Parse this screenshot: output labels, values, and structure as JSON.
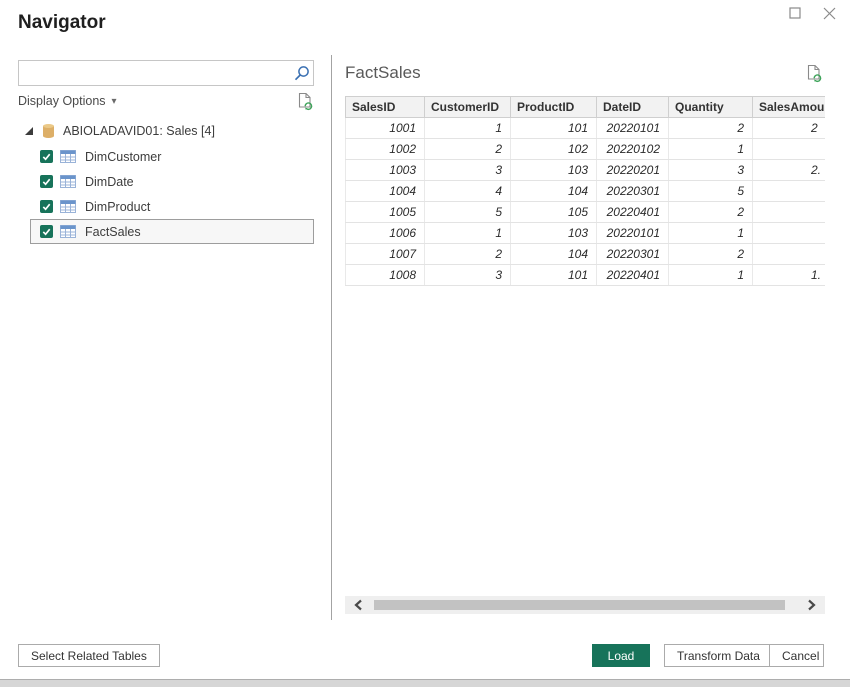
{
  "window": {
    "title": "Navigator"
  },
  "left_panel": {
    "search": {
      "placeholder": ""
    },
    "display_options_label": "Display Options",
    "display_options_caret": "▾",
    "tree": {
      "root_label": "ABIOLADAVID01: Sales [4]",
      "items": [
        {
          "label": "DimCustomer",
          "checked": true,
          "selected": false
        },
        {
          "label": "DimDate",
          "checked": true,
          "selected": false
        },
        {
          "label": "DimProduct",
          "checked": true,
          "selected": false
        },
        {
          "label": "FactSales",
          "checked": true,
          "selected": true
        }
      ]
    }
  },
  "preview": {
    "title": "FactSales",
    "table": {
      "columns": [
        "SalesID",
        "CustomerID",
        "ProductID",
        "DateID",
        "Quantity",
        "SalesAmount"
      ],
      "rows": [
        [
          "1001",
          "1",
          "101",
          "20220101",
          "2",
          "2"
        ],
        [
          "1002",
          "2",
          "102",
          "20220102",
          "1",
          ""
        ],
        [
          "1003",
          "3",
          "103",
          "20220201",
          "3",
          "2."
        ],
        [
          "1004",
          "4",
          "104",
          "20220301",
          "5",
          ""
        ],
        [
          "1005",
          "5",
          "105",
          "20220401",
          "2",
          ""
        ],
        [
          "1006",
          "1",
          "103",
          "20220101",
          "1",
          ""
        ],
        [
          "1007",
          "2",
          "104",
          "20220301",
          "2",
          ""
        ],
        [
          "1008",
          "3",
          "101",
          "20220401",
          "1",
          "1."
        ]
      ]
    }
  },
  "footer": {
    "select_related_label": "Select Related Tables",
    "load_label": "Load",
    "transform_label": "Transform Data",
    "cancel_label": "Cancel"
  },
  "colors": {
    "accent_green": "#17735A",
    "icon_blue": "#3A70B2",
    "db_tan": "#DDAF68",
    "refresh_green": "#3FA45B"
  }
}
